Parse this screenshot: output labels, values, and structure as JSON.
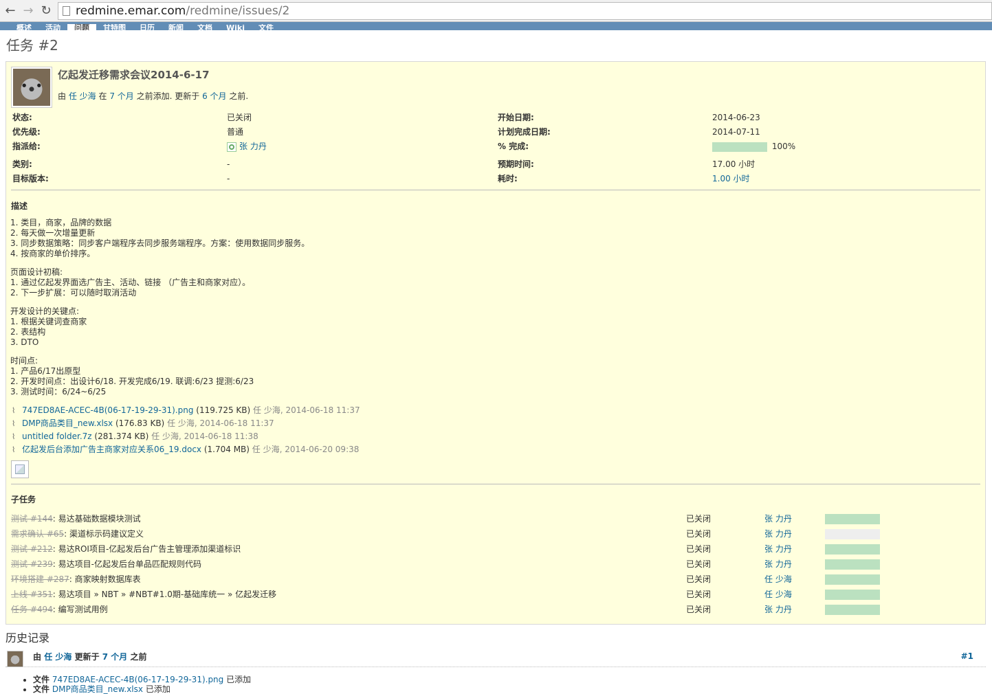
{
  "browser": {
    "url_host": "redmine.emar.com",
    "url_path": "/redmine/issues/2"
  },
  "menu": {
    "items": [
      {
        "label": "概述",
        "selected": false
      },
      {
        "label": "活动",
        "selected": false
      },
      {
        "label": "问题",
        "selected": true
      },
      {
        "label": "甘特图",
        "selected": false
      },
      {
        "label": "日历",
        "selected": false
      },
      {
        "label": "新闻",
        "selected": false
      },
      {
        "label": "文档",
        "selected": false
      },
      {
        "label": "Wiki",
        "selected": false
      },
      {
        "label": "文件",
        "selected": false
      }
    ]
  },
  "page_title": "任务 #2",
  "issue": {
    "subject": "亿起发迁移需求会议2014-6-17",
    "author_line": {
      "prefix": "由",
      "author": "任 少海",
      "in": "在",
      "added_ago": "7 个月",
      "added_suffix": "之前添加. 更新于",
      "updated_ago": "6 个月",
      "updated_suffix": "之前."
    },
    "attributes_left": [
      {
        "label": "状态:",
        "value": "已关闭"
      },
      {
        "label": "优先级:",
        "value": "普通"
      },
      {
        "label": "指派给:",
        "value": "张 力丹",
        "link": true
      },
      {
        "label": "类别:",
        "value": "-"
      },
      {
        "label": "目标版本:",
        "value": "-"
      }
    ],
    "attributes_right": [
      {
        "label": "开始日期:",
        "value": "2014-06-23"
      },
      {
        "label": "计划完成日期:",
        "value": "2014-07-11"
      },
      {
        "label": "% 完成:",
        "value": "100%",
        "progress": 100
      },
      {
        "label": "预期时间:",
        "value": "17.00 小时"
      },
      {
        "label": "耗时:",
        "value": "1.00 小时",
        "link": true
      }
    ],
    "description_title": "描述",
    "description": [
      [
        "1. 类目，商家，品牌的数据",
        "2. 每天做一次增量更新",
        "3. 同步数据策略：同步客户端程序去同步服务端程序。方案：使用数据同步服务。",
        "4. 按商家的单价排序。"
      ],
      [
        "页面设计初稿:",
        "1. 通过亿起发界面选广告主、活动、链接 （广告主和商家对应）。",
        "2. 下一步扩展：可以随时取消活动"
      ],
      [
        "开发设计的关键点:",
        "1. 根据关键词查商家",
        "2. 表结构",
        "3. DTO"
      ],
      [
        "时间点:",
        "1. 产品6/17出原型",
        "2. 开发时间点：出设计6/18. 开发完成6/19. 联调:6/23 提测:6/23",
        "3. 测试时间：6/24~6/25"
      ]
    ],
    "attachments": [
      {
        "name": "747ED8AE-ACEC-4B(06-17-19-29-31).png",
        "size": "(119.725 KB)",
        "author": "任 少海, 2014-06-18 11:37"
      },
      {
        "name": "DMP商品类目_new.xlsx",
        "size": "(176.83 KB)",
        "author": "任 少海, 2014-06-18 11:37"
      },
      {
        "name": "untitled folder.7z",
        "size": "(281.374 KB)",
        "author": "任 少海, 2014-06-18 11:38"
      },
      {
        "name": "亿起发后台添加广告主商家对应关系06_19.docx",
        "size": "(1.704 MB)",
        "author": "任 少海, 2014-06-20 09:38"
      }
    ],
    "subtasks_title": "子任务",
    "subtasks": [
      {
        "tracker": "测试 #144",
        "subject": ": 易达基础数据模块测试",
        "status": "已关闭",
        "assignee": "张 力丹",
        "progress": 100
      },
      {
        "tracker": "需求确认 #65",
        "subject": ": 渠道标示码建议定义",
        "status": "已关闭",
        "assignee": "张 力丹",
        "progress": 0
      },
      {
        "tracker": "测试 #212",
        "subject": ": 易达ROI项目-亿起发后台广告主管理添加渠道标识",
        "status": "已关闭",
        "assignee": "张 力丹",
        "progress": 100
      },
      {
        "tracker": "测试 #239",
        "subject": ": 易达项目-亿起发后台单品匹配规则代码",
        "status": "已关闭",
        "assignee": "张 力丹",
        "progress": 100
      },
      {
        "tracker": "环境搭建 #287",
        "subject": ": 商家映射数据库表",
        "status": "已关闭",
        "assignee": "任 少海",
        "progress": 100
      },
      {
        "tracker": "上线 #351",
        "subject": ": 易达项目 » NBT » #NBT#1.0期-基础库统一 » 亿起发迁移",
        "status": "已关闭",
        "assignee": "任 少海",
        "progress": 100
      },
      {
        "tracker": "任务 #494",
        "subject": ": 编写测试用例",
        "status": "已关闭",
        "assignee": "张 力丹",
        "progress": 100
      }
    ]
  },
  "history": {
    "title": "历史记录",
    "entries": [
      {
        "prefix": "由",
        "author": "任 少海",
        "mid": "更新于",
        "ago": "7 个月",
        "suffix": "之前",
        "number": "#1",
        "details": [
          {
            "label": "文件",
            "value": "747ED8AE-ACEC-4B(06-17-19-29-31).png",
            "action": "已添加"
          },
          {
            "label": "文件",
            "value": "DMP商品类目_new.xlsx",
            "action": "已添加"
          }
        ]
      }
    ]
  }
}
